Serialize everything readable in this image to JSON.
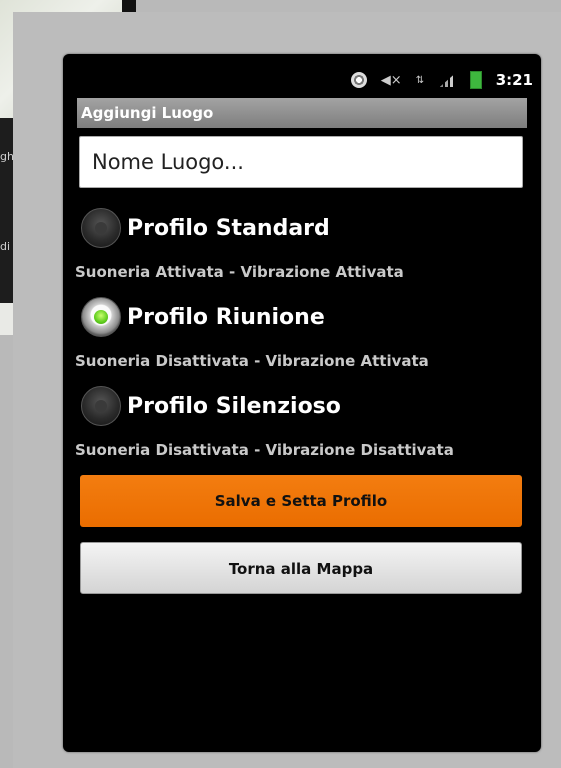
{
  "background": {
    "partial_text_1": "gh",
    "partial_text_2": "di"
  },
  "status_bar": {
    "time": "3:21",
    "icons": [
      "gps-icon",
      "mute-icon",
      "network-3g-icon",
      "signal-icon",
      "battery-icon"
    ]
  },
  "app": {
    "title": "Aggiungi Luogo",
    "name_input": {
      "value": "Nome Luogo...",
      "placeholder": "Nome Luogo..."
    },
    "profiles": [
      {
        "label": "Profilo Standard",
        "description": "Suoneria Attivata - Vibrazione Attivata",
        "selected": false
      },
      {
        "label": "Profilo Riunione",
        "description": "Suoneria Disattivata - Vibrazione Attivata",
        "selected": true
      },
      {
        "label": "Profilo Silenzioso",
        "description": "Suoneria Disattivata - Vibrazione Disattivata",
        "selected": false
      }
    ],
    "buttons": {
      "save_label": "Salva e Setta Profilo",
      "back_label": "Torna alla Mappa"
    }
  },
  "colors": {
    "accent": "#f07a0a",
    "selected_radio": "#5fcc1d"
  }
}
